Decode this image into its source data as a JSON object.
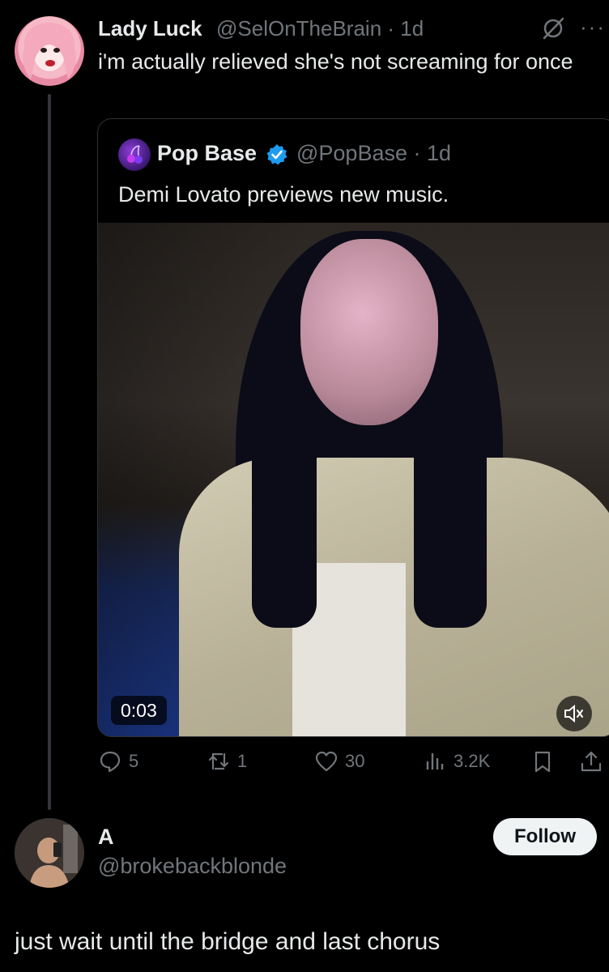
{
  "tweet": {
    "author_name": "Lady Luck",
    "author_meta": "@SelOnTheBrain · 1d",
    "text": "i'm actually relieved she's not screaming for once",
    "more_label": "···"
  },
  "quote": {
    "author_name": "Pop Base",
    "author_meta": "@PopBase · 1d",
    "text": "Demi Lovato previews new music.",
    "video_time": "0:03"
  },
  "actions": {
    "replies": "5",
    "reposts": "1",
    "likes": "30",
    "views": "3.2K"
  },
  "reply_user": {
    "name": "A",
    "handle": "@brokebackblonde",
    "follow_label": "Follow",
    "text": "just wait until the bridge and last chorus"
  },
  "colors": {
    "background": "#000000",
    "text": "#e7e9ea",
    "muted": "#71767b",
    "verified": "#1d9bf0"
  }
}
